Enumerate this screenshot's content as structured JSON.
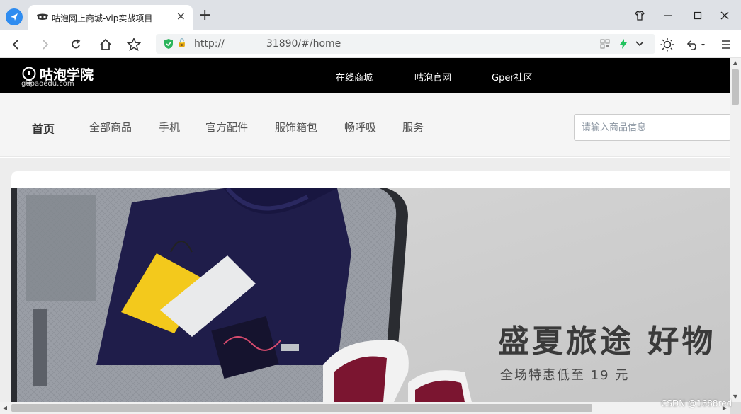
{
  "browser": {
    "tab_title": "咕泡网上商城-vip实战项目",
    "url_prefix": "http://",
    "url_suffix": "31890/#/home",
    "tab_close": "×",
    "new_tab": "+"
  },
  "site": {
    "logo_main": "咕泡学院",
    "logo_sub": "gupaoedu.com",
    "header_links": [
      "在线商城",
      "咕泡官网",
      "Gper社区"
    ]
  },
  "nav": {
    "items": [
      "首页",
      "全部商品",
      "手机",
      "官方配件",
      "服饰箱包",
      "畅呼吸",
      "服务"
    ],
    "search_placeholder": "请输入商品信息"
  },
  "banner": {
    "headline": "盛夏旅途 好物",
    "subline": "全场特惠低至 19 元"
  },
  "watermark": "CSDN @1688red",
  "colors": {
    "header_bg": "#000000",
    "nav_bg": "#f5f5f5",
    "browser_accent": "#2f8cf0"
  }
}
